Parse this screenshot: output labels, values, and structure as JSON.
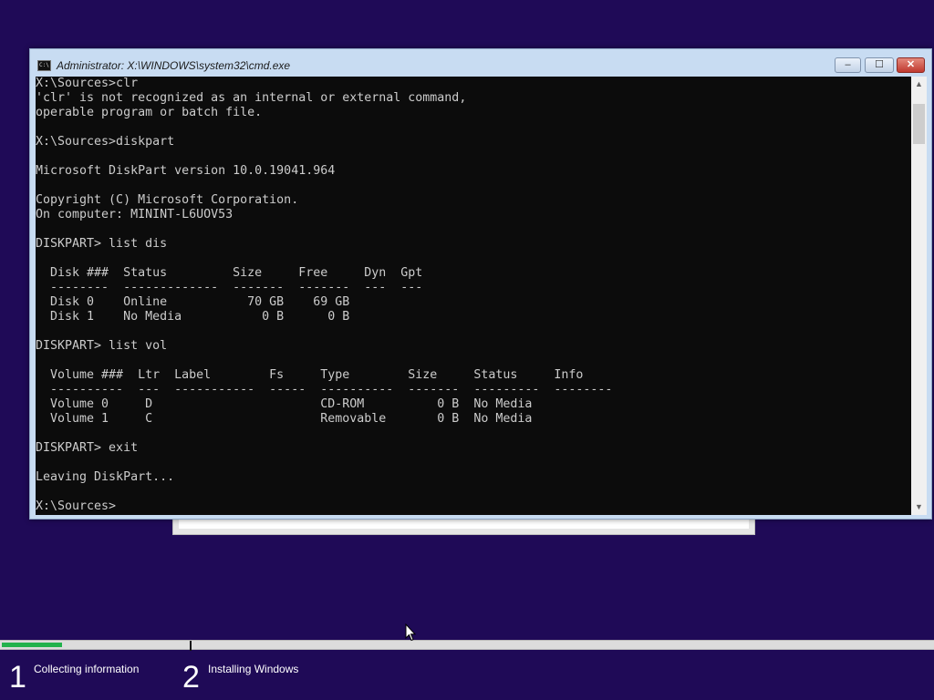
{
  "window": {
    "title": "Administrator: X:\\WINDOWS\\system32\\cmd.exe",
    "icon_text": "C:\\",
    "minimize_glyph": "–",
    "maximize_glyph": "☐",
    "close_glyph": "✕"
  },
  "console": {
    "lines": [
      "X:\\Sources>clr",
      "'clr' is not recognized as an internal or external command,",
      "operable program or batch file.",
      "",
      "X:\\Sources>diskpart",
      "",
      "Microsoft DiskPart version 10.0.19041.964",
      "",
      "Copyright (C) Microsoft Corporation.",
      "On computer: MININT-L6UOV53",
      "",
      "DISKPART> list dis",
      "",
      "  Disk ###  Status         Size     Free     Dyn  Gpt",
      "  --------  -------------  -------  -------  ---  ---",
      "  Disk 0    Online           70 GB    69 GB",
      "  Disk 1    No Media           0 B      0 B",
      "",
      "DISKPART> list vol",
      "",
      "  Volume ###  Ltr  Label        Fs     Type        Size     Status     Info",
      "  ----------  ---  -----------  -----  ----------  -------  ---------  --------",
      "  Volume 0     D                       CD-ROM          0 B  No Media",
      "  Volume 1     C                       Removable       0 B  No Media",
      "",
      "DISKPART> exit",
      "",
      "Leaving DiskPart...",
      "",
      "X:\\Sources>"
    ]
  },
  "scrollbar": {
    "up_glyph": "▲",
    "down_glyph": "▼"
  },
  "setup": {
    "progress_fraction": 0.065,
    "steps": [
      {
        "number": "1",
        "label": "Collecting information"
      },
      {
        "number": "2",
        "label": "Installing Windows"
      }
    ]
  },
  "colors": {
    "background": "#1f0a57",
    "progress": "#22b24c",
    "console_bg": "#0c0c0c",
    "console_text": "#cccccc"
  }
}
